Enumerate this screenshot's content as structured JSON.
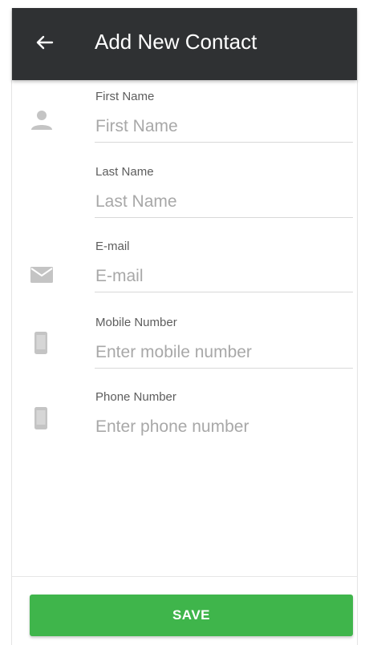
{
  "header": {
    "title": "Add New Contact",
    "back_icon": "arrow-back-icon",
    "background": "#2f3133"
  },
  "form": {
    "first_name": {
      "label": "First Name",
      "placeholder": "First Name",
      "value": "",
      "icon": "person-icon"
    },
    "last_name": {
      "label": "Last Name",
      "placeholder": "Last Name",
      "value": ""
    },
    "email": {
      "label": "E-mail",
      "placeholder": "E-mail",
      "value": "",
      "icon": "mail-icon"
    },
    "mobile": {
      "label": "Mobile Number",
      "placeholder": "Enter mobile number",
      "value": "",
      "icon": "phone-icon"
    },
    "phone": {
      "label": "Phone Number",
      "placeholder": "Enter phone number",
      "value": "",
      "icon": "phone-icon"
    }
  },
  "actions": {
    "save_label": "SAVE",
    "save_color": "#3fb54b"
  },
  "colors": {
    "icon": "#c4c4c4",
    "label": "#5d5d5d",
    "placeholder": "#a8a8a8",
    "divider": "#d8d8d8"
  }
}
